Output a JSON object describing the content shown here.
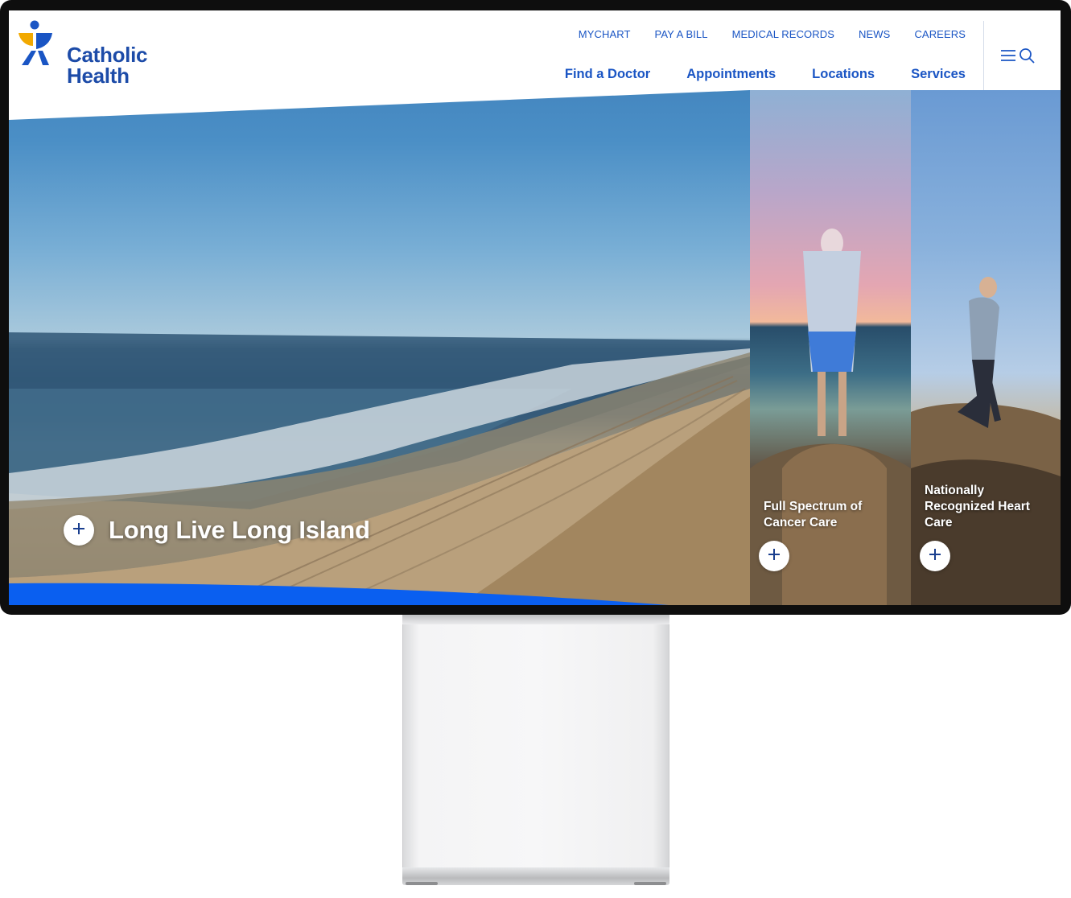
{
  "brand": {
    "name_line1": "Catholic",
    "name_line2": "Health"
  },
  "utility_nav": [
    "MYCHART",
    "PAY A BILL",
    "MEDICAL RECORDS",
    "NEWS",
    "CAREERS"
  ],
  "main_nav": [
    "Find a Doctor",
    "Appointments",
    "Locations",
    "Services"
  ],
  "menu": {
    "icons": [
      "hamburger-icon",
      "search-icon"
    ]
  },
  "hero": {
    "title": "Long Live Long Island",
    "icon": "plus-icon"
  },
  "panels": [
    {
      "title": "Full Spectrum of Cancer Care",
      "icon": "plus-icon"
    },
    {
      "title": "Nationally Recognized Heart Care",
      "icon": "plus-icon"
    }
  ],
  "colors": {
    "brand_blue": "#1a55c4",
    "accent_blue": "#0a5ff0",
    "logo_gold": "#f2a900"
  }
}
